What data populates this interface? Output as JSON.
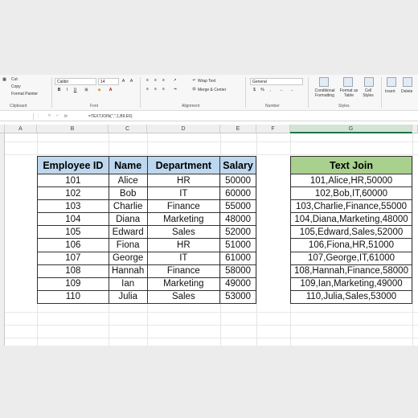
{
  "ribbon": {
    "clipboard": {
      "cut": "Cut",
      "copy": "Copy",
      "format_painter": "Format Painter",
      "group": "Clipboard"
    },
    "font": {
      "name": "Calibri",
      "size": "14",
      "group": "Font",
      "bold": "B",
      "italic": "I",
      "underline": "U"
    },
    "alignment": {
      "wrap_text": "Wrap Text",
      "merge_center": "Merge & Center",
      "group": "Alignment"
    },
    "number": {
      "format": "General",
      "group": "Number"
    },
    "styles": {
      "conditional_formatting": "Conditional Formatting",
      "format_as_table": "Format as Table",
      "cell_styles": "Cell Styles",
      "group": "Styles"
    },
    "cells": {
      "insert": "Insert",
      "delete": "Delete"
    }
  },
  "formula_bar": {
    "fx": "fx",
    "formula": "=TEXTJOIN(\",\",1,B6:E6)"
  },
  "columns": [
    "A",
    "B",
    "C",
    "D",
    "E",
    "F",
    "G"
  ],
  "colors": {
    "header_blue": "#bdd7ee",
    "header_green": "#a9d18e",
    "excel_green": "#217346"
  },
  "employee_table": {
    "headers": [
      "Employee ID",
      "Name",
      "Department",
      "Salary"
    ],
    "rows": [
      [
        "101",
        "Alice",
        "HR",
        "50000"
      ],
      [
        "102",
        "Bob",
        "IT",
        "60000"
      ],
      [
        "103",
        "Charlie",
        "Finance",
        "55000"
      ],
      [
        "104",
        "Diana",
        "Marketing",
        "48000"
      ],
      [
        "105",
        "Edward",
        "Sales",
        "52000"
      ],
      [
        "106",
        "Fiona",
        "HR",
        "51000"
      ],
      [
        "107",
        "George",
        "IT",
        "61000"
      ],
      [
        "108",
        "Hannah",
        "Finance",
        "58000"
      ],
      [
        "109",
        "Ian",
        "Marketing",
        "49000"
      ],
      [
        "110",
        "Julia",
        "Sales",
        "53000"
      ]
    ]
  },
  "textjoin_table": {
    "header": "Text Join",
    "rows": [
      "101,Alice,HR,50000",
      "102,Bob,IT,60000",
      "103,Charlie,Finance,55000",
      "104,Diana,Marketing,48000",
      "105,Edward,Sales,52000",
      "106,Fiona,HR,51000",
      "107,George,IT,61000",
      "108,Hannah,Finance,58000",
      "109,Ian,Marketing,49000",
      "110,Julia,Sales,53000"
    ]
  }
}
